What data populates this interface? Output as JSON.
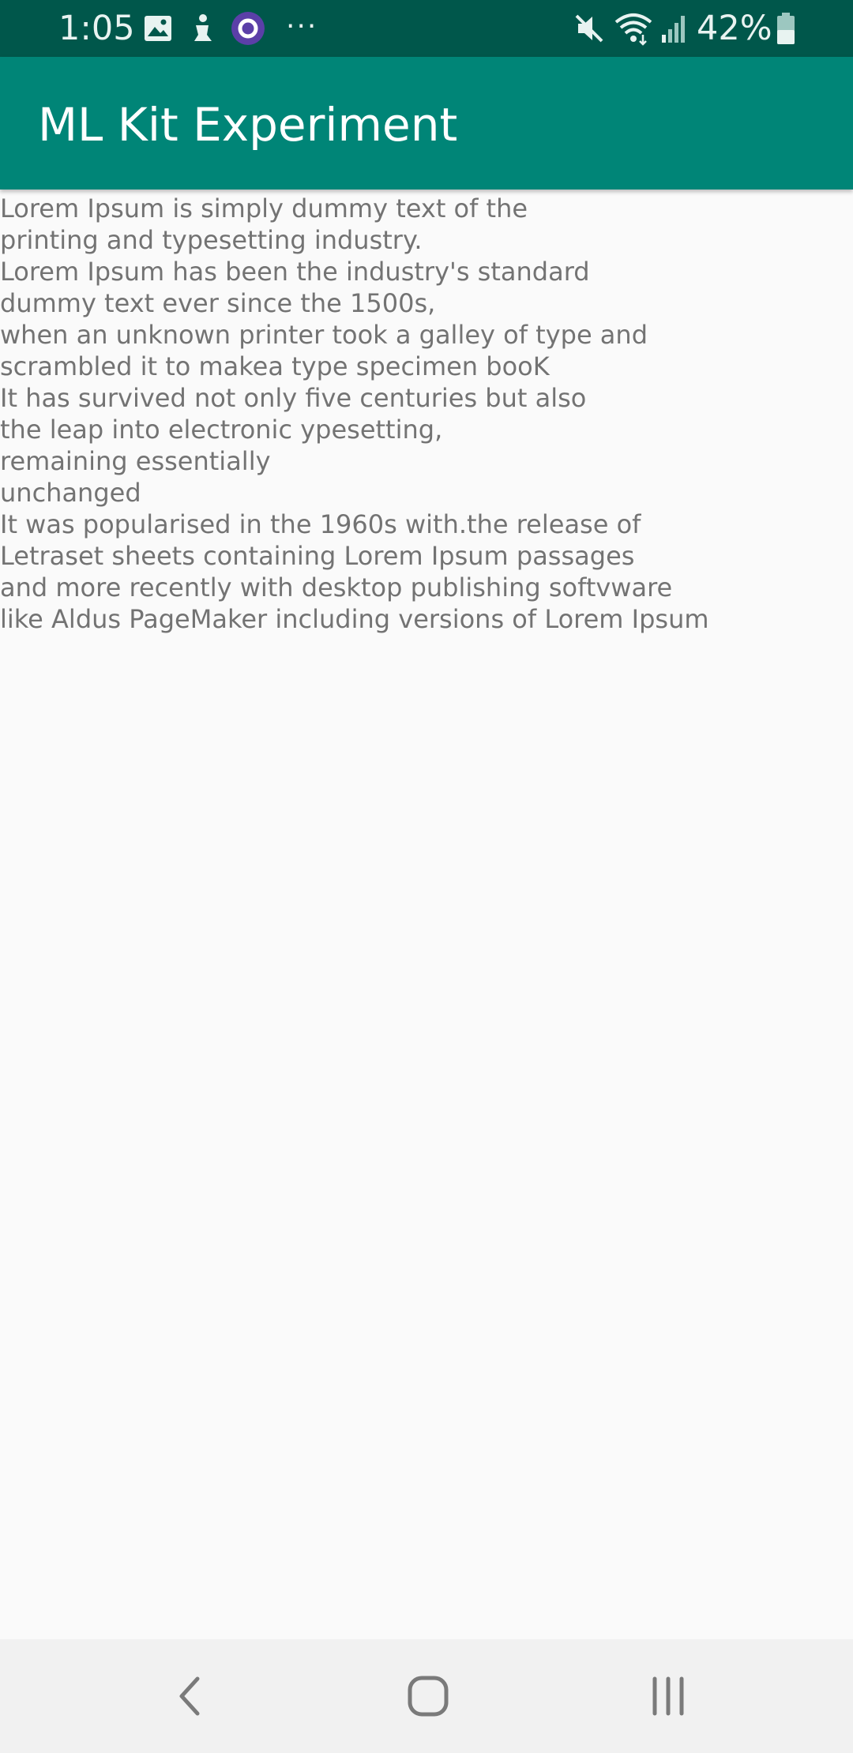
{
  "status_bar": {
    "time": "1:05",
    "battery_percent": "42%",
    "icons": [
      "image-icon",
      "accessibility-icon",
      "circle-app-icon",
      "more-icon",
      "mute-icon",
      "wifi-icon",
      "signal-icon",
      "battery-icon"
    ],
    "more_dots": "···"
  },
  "app_bar": {
    "title": "ML Kit Experiment"
  },
  "content": {
    "lines": [
      "Lorem Ipsum is simply dummy text of the",
      "printing and typesetting industry.",
      "Lorem Ipsum has been the industry's standard",
      "dummy text ever since the 1500s,",
      "when an unknown printer took a galley of type and",
      "scrambled it to makea type specimen booK",
      "It has survived not only five centuries but also",
      "the leap into electronic ypesetting,",
      "remaining essentially",
      "unchanged",
      "It was popularised in the 1960s with.the release of",
      "Letraset sheets containing Lorem Ipsum passages",
      "and more recently with desktop publishing softvware",
      "like Aldus PageMaker including versions of Lorem Ipsum"
    ]
  },
  "nav_bar": {
    "buttons": [
      "back-icon",
      "home-icon",
      "recents-icon"
    ]
  },
  "colors": {
    "status_bar_bg": "#00574b",
    "app_bar_bg": "#008577",
    "body_text": "#737373",
    "background": "#fafafa",
    "nav_bar_bg": "#f1f1f1"
  }
}
